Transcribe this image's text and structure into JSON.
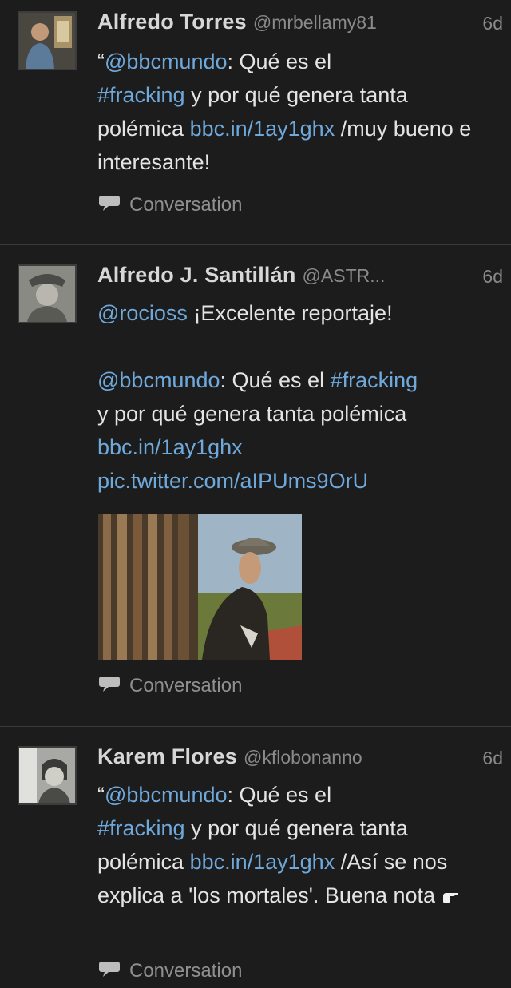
{
  "tweets": [
    {
      "name": "Alfredo Torres",
      "handle": "@mrbellamy81",
      "time": "6d",
      "text": {
        "p1": "“",
        "m1": "@bbcmundo",
        "p2": ": Qué es el",
        "h1": "#fracking",
        "p3": " y por qué genera tanta polémica ",
        "l1": "bbc.in/1ay1ghx",
        "p4": " /muy bueno e interesante!"
      },
      "conversation": "Conversation"
    },
    {
      "name": "Alfredo J. Santillán",
      "handle": "@ASTR...",
      "time": "6d",
      "text": {
        "m1": "@rocioss",
        "p1": " ¡Excelente reportaje!",
        "m2": "@bbcmundo",
        "p2": ": Qué es el ",
        "h1": "#fracking",
        "p3": " y por qué genera tanta polémica",
        "l1": "bbc.in/1ay1ghx",
        "l2": "pic.twitter.com/aIPUms9OrU"
      },
      "conversation": "Conversation"
    },
    {
      "name": "Karem Flores",
      "handle": "@kflobonanno",
      "time": "6d",
      "text": {
        "p1": "“",
        "m1": "@bbcmundo",
        "p2": ": Qué es el",
        "h1": "#fracking",
        "p3": " y por qué genera tanta polémica ",
        "l1": "bbc.in/1ay1ghx",
        "p4": " /Así se nos explica a 'los mortales'. Buena nota "
      },
      "conversation": "Conversation"
    }
  ]
}
